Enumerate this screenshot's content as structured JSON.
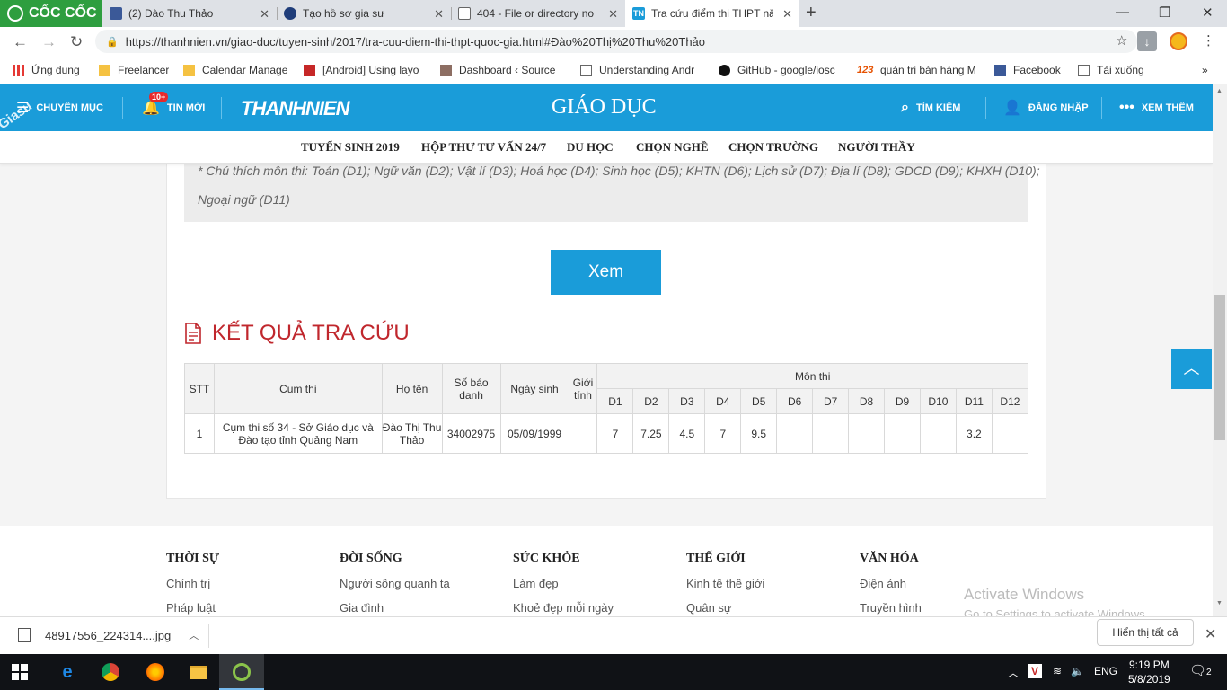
{
  "browser": {
    "brand": "CỐC CỐC",
    "tabs": [
      {
        "label": "(2) Đào Thu Thảo"
      },
      {
        "label": "Tạo hồ sơ gia sư"
      },
      {
        "label": "404 - File or directory not"
      },
      {
        "label": "Tra cứu điểm thi THPT nă"
      }
    ],
    "url": "https://thanhnien.vn/giao-duc/tuyen-sinh/2017/tra-cuu-diem-thi-thpt-quoc-gia.html#Đào%20Thị%20Thu%20Thảo",
    "bookmarks": [
      "Ứng dụng",
      "Freelancer",
      "Calendar Manage",
      "[Android] Using layo",
      "Dashboard ‹ Source",
      "Understanding Andr",
      "GitHub - google/iosc",
      "quản trị bán hàng M",
      "Facebook",
      "Tải xuống"
    ]
  },
  "site": {
    "watermark": "Giasu",
    "header": {
      "categories": "CHUYÊN MỤC",
      "news": "TIN MỚI",
      "news_badge": "10+",
      "logo": "THANHNIEN",
      "section": "GIÁO DỤC",
      "search": "TÌM KIẾM",
      "login": "ĐĂNG NHẬP",
      "more": "XEM THÊM"
    },
    "subnav": [
      "TUYỂN SINH 2019",
      "HỘP THƯ TƯ VẤN 24/7",
      "DU HỌC",
      "CHỌN NGHỀ",
      "CHỌN TRƯỜNG",
      "NGƯỜI THẦY"
    ],
    "note_line1": "* Chú thích môn thi: Toán (D1); Ngữ văn (D2); Vật lí (D3); Hoá học (D4); Sinh học (D5); KHTN (D6); Lịch sử (D7); Địa lí (D8); GDCD (D9); KHXH (D10);",
    "note_line2": "Ngoại ngữ (D11)",
    "submit_label": "Xem",
    "result_title": "KẾT QUẢ TRA CỨU",
    "table": {
      "headers": {
        "stt": "STT",
        "cluster": "Cụm thi",
        "name": "Họ tên",
        "sbd": "Số báo danh",
        "dob": "Ngày sinh",
        "gender": "Giới tính",
        "subjects": "Môn thi"
      },
      "subject_cols": [
        "D1",
        "D2",
        "D3",
        "D4",
        "D5",
        "D6",
        "D7",
        "D8",
        "D9",
        "D10",
        "D11",
        "D12"
      ],
      "row": {
        "stt": "1",
        "cluster": "Cụm thi số 34 - Sở Giáo dục và Đào tạo tỉnh Quảng Nam",
        "name": "Đào Thị Thu Thảo",
        "sbd": "34002975",
        "dob": "05/09/1999",
        "gender": "",
        "scores": [
          "7",
          "7.25",
          "4.5",
          "7",
          "9.5",
          "",
          "",
          "",
          "",
          "",
          "3.2",
          ""
        ]
      }
    },
    "footer": [
      {
        "heading": "THỜI SỰ",
        "links": [
          "Chính trị",
          "Pháp luật"
        ]
      },
      {
        "heading": "ĐỜI SỐNG",
        "links": [
          "Người sống quanh ta",
          "Gia đình"
        ]
      },
      {
        "heading": "SỨC KHỎE",
        "links": [
          "Làm đẹp",
          "Khoẻ đẹp mỗi ngày"
        ]
      },
      {
        "heading": "THẾ GIỚI",
        "links": [
          "Kinh tế thế giới",
          "Quân sự"
        ]
      },
      {
        "heading": "VĂN HÓA",
        "links": [
          "Điện ảnh",
          "Truyền hình"
        ]
      }
    ]
  },
  "activation": {
    "line1": "Activate Windows",
    "line2": "Go to Settings to activate Windows."
  },
  "download_bar": {
    "file": "48917556_224314....jpg",
    "show_all": "Hiển thị tất cả"
  },
  "taskbar": {
    "lang": "ENG",
    "time": "9:19 PM",
    "date": "5/8/2019",
    "notifications": "2"
  }
}
